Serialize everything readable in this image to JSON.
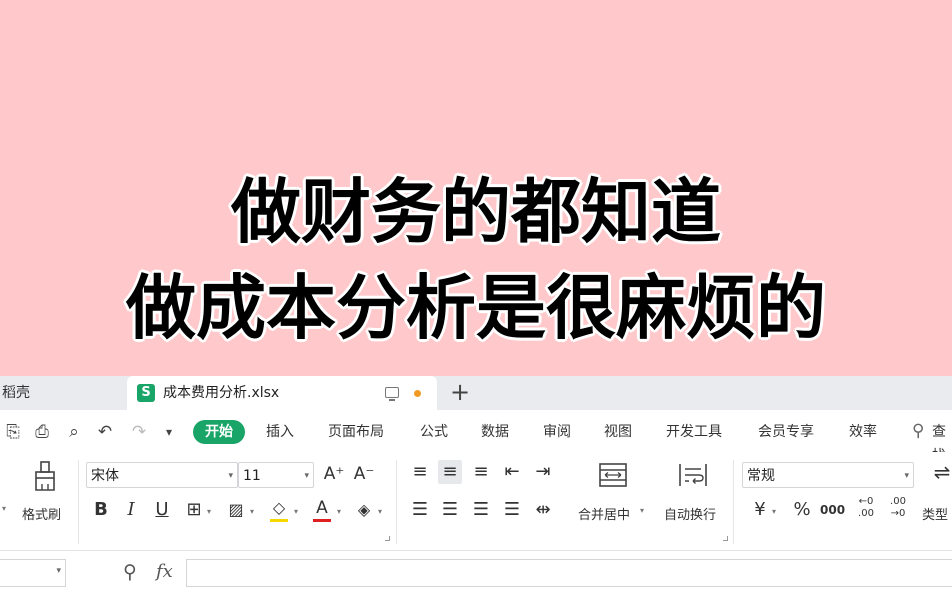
{
  "overlay": {
    "line1": "做财务的都知道",
    "line2": "做成本分析是很麻烦的"
  },
  "tabs": {
    "inactive": "稻壳",
    "active_icon": "S",
    "active_title": "成本费用分析.xlsx",
    "new_tab": "+"
  },
  "menu": {
    "items": [
      "开始",
      "插入",
      "页面布局",
      "公式",
      "数据",
      "审阅",
      "视图",
      "开发工具",
      "会员专享",
      "效率"
    ],
    "search_label": "查找"
  },
  "ribbon": {
    "format_painter": "格式刷",
    "font_name": "宋体",
    "font_size": "11",
    "grow_font": "A⁺",
    "shrink_font": "A⁻",
    "bold": "B",
    "italic": "I",
    "underline": "U",
    "merge_center": "合并居中",
    "wrap_text": "自动换行",
    "number_format": "常规",
    "currency": "¥",
    "percent": "%",
    "thousands": "000",
    "inc_decimal": "←0 .00",
    "dec_decimal": ".00 →0",
    "type_convert": "类型"
  },
  "formula": {
    "fx": "fx"
  },
  "colors": {
    "banner_bg": "#ffc8ca",
    "accent_green": "#1aa568",
    "fill_yellow": "#f5d800",
    "font_red": "#e02020"
  }
}
